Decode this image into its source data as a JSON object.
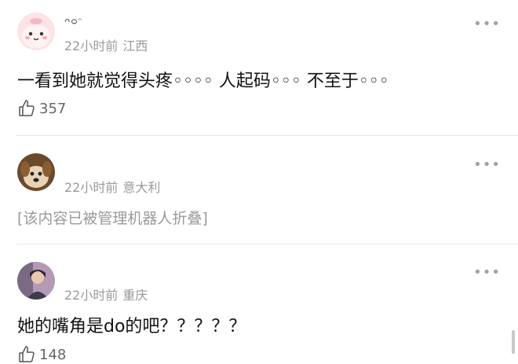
{
  "comments": [
    {
      "username": "ᴖᴑᵔ",
      "time": "22小时前",
      "location": "江西",
      "text": "一看到她就觉得头疼◦◦◦◦ 人起码◦◦◦ 不至于◦◦◦",
      "likes": "357",
      "avatar_icon": "cartoon-face-icon"
    },
    {
      "username": "",
      "time": "22小时前",
      "location": "意大利",
      "folded_notice": "[该内容已被管理机器人折叠]",
      "avatar_icon": "dog-photo-icon"
    },
    {
      "username": "",
      "time": "22小时前",
      "location": "重庆",
      "text": "她的嘴角是do的吧？？？？？",
      "likes": "148",
      "avatar_icon": "person-photo-icon"
    }
  ],
  "more_label": "•••",
  "colors": {
    "meta": "#9a9a9a",
    "divider": "#e7e7e7",
    "text": "#111111"
  }
}
